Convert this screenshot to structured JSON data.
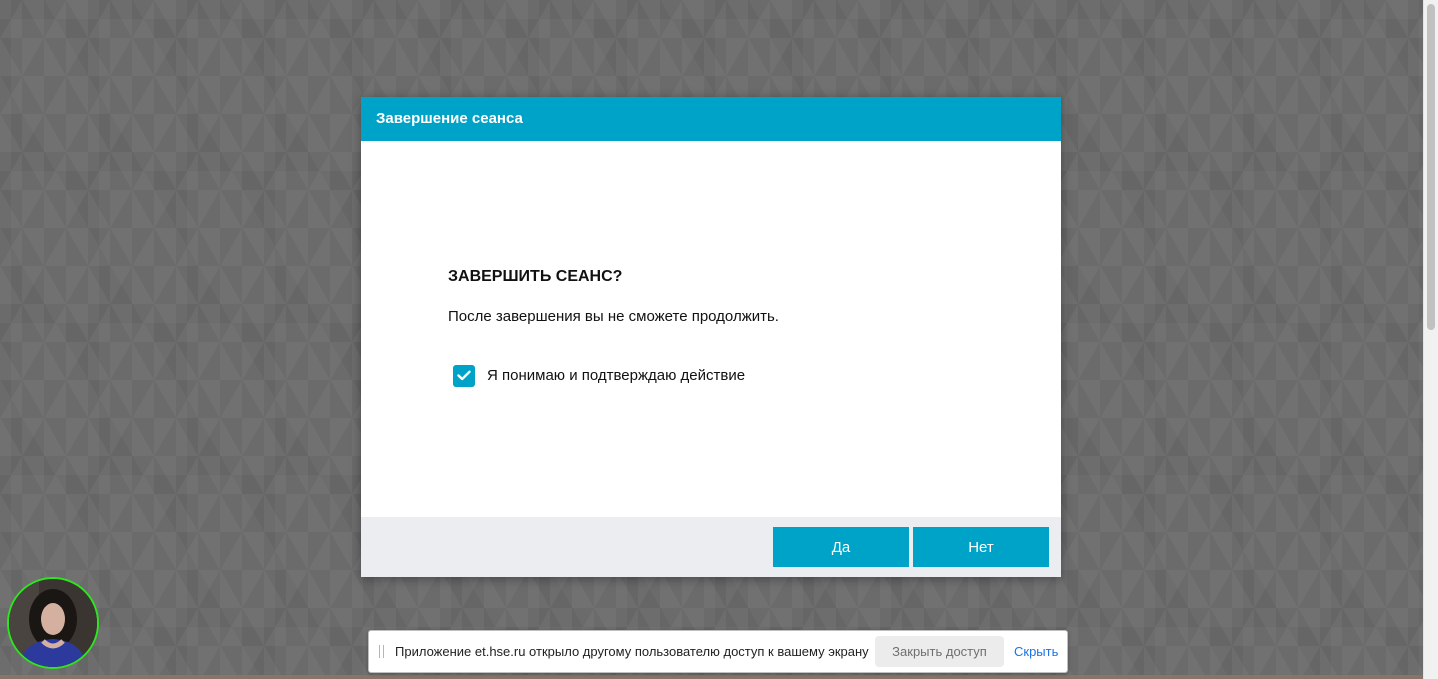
{
  "dialog": {
    "title": "Завершение сеанса",
    "heading": "ЗАВЕРШИТЬ СЕАНС?",
    "message": "После завершения вы не сможете продолжить.",
    "confirm_label": "Я понимаю и подтверждаю действие",
    "confirm_checked": true,
    "yes_label": "Да",
    "no_label": "Нет",
    "accent_color": "#00a3c8"
  },
  "share_bar": {
    "message": "Приложение et.hse.ru открыло другому пользователю доступ к вашему экрану",
    "stop_label": "Закрыть доступ",
    "hide_label": "Скрыть"
  },
  "camera": {
    "icon": "webcam-preview",
    "border_color": "#2ee51f"
  }
}
